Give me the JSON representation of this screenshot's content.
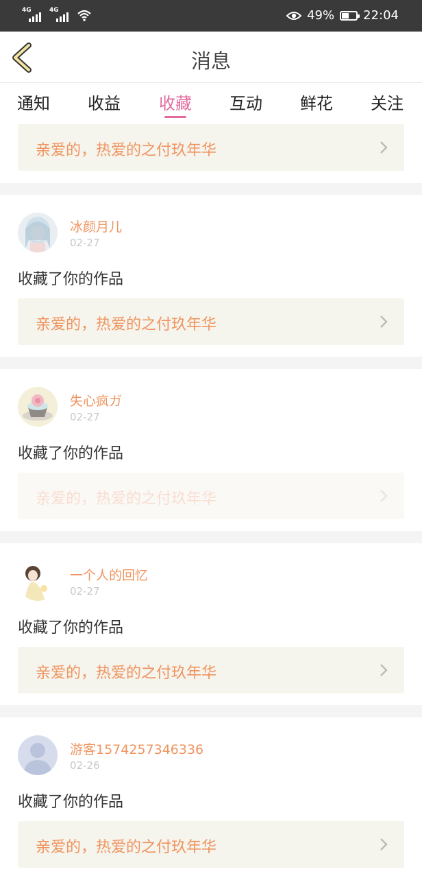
{
  "status_bar": {
    "net1": "4G",
    "net2": "4G",
    "battery_pct": "49%",
    "battery_level": 0.49,
    "time": "22:04"
  },
  "header": {
    "title": "消息"
  },
  "tabs": [
    {
      "label": "通知"
    },
    {
      "label": "收益"
    },
    {
      "label": "收藏"
    },
    {
      "label": "互动"
    },
    {
      "label": "鲜花"
    },
    {
      "label": "关注"
    }
  ],
  "active_tab": "收藏",
  "top_card": {
    "work_title": "亲爱的，热爱的之付玖年华"
  },
  "messages": [
    {
      "username": "冰颜月儿",
      "date": "02-27",
      "action": "收藏了你的作品",
      "work_title": "亲爱的，热爱的之付玖年华"
    },
    {
      "username": "失心疯ガ",
      "date": "02-27",
      "action": "收藏了你的作品",
      "work_title": "亲爱的，热爱的之付玖年华"
    },
    {
      "username": "一个人的回忆",
      "date": "02-27",
      "action": "收藏了你的作品",
      "work_title": "亲爱的，热爱的之付玖年华"
    },
    {
      "username": "游客1574257346336",
      "date": "02-26",
      "action": "收藏了你的作品",
      "work_title": "亲爱的，热爱的之付玖年华"
    }
  ],
  "colors": {
    "accent": "#e26a9f",
    "username": "#f0945f",
    "link_bg": "#f5f4ed"
  }
}
